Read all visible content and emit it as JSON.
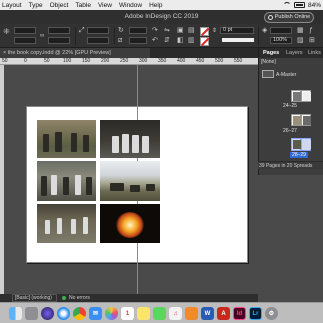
{
  "menubar": {
    "items": [
      "Layout",
      "Type",
      "Object",
      "Table",
      "View",
      "Window",
      "Help"
    ],
    "battery": "84%"
  },
  "window": {
    "title": "Adobe InDesign CC 2019",
    "publish_label": "Publish Online"
  },
  "controlbar": {
    "stroke_weight": "0 pt",
    "scale_percent": "100%"
  },
  "doc_tab": {
    "label": "the book copy.indd @ 22% [GPU Preview]"
  },
  "ruler": {
    "labels": [
      "50",
      "0",
      "50",
      "100",
      "150",
      "200",
      "250",
      "300",
      "350",
      "400",
      "450",
      "500",
      "550"
    ]
  },
  "pages_panel": {
    "tabs": [
      "Pages",
      "Layers",
      "Links"
    ],
    "none_label": "[None]",
    "master_label": "A-Master",
    "spreads": [
      "24–25",
      "26–27",
      "28–29"
    ],
    "summary": "39 Pages in 20 Spreads"
  },
  "statusbar": {
    "profile": "[Basic] (working)",
    "preflight": "No errors"
  },
  "dock": {
    "apps": [
      "Finder",
      "Launchpad",
      "Siri",
      "Safari",
      "Chrome",
      "Mail",
      "Photos",
      "Calendar",
      "Notes",
      "Messages",
      "Music",
      "Books",
      "Word",
      "Acrobat",
      "InDesign",
      "Lightroom",
      "System Preferences"
    ]
  }
}
